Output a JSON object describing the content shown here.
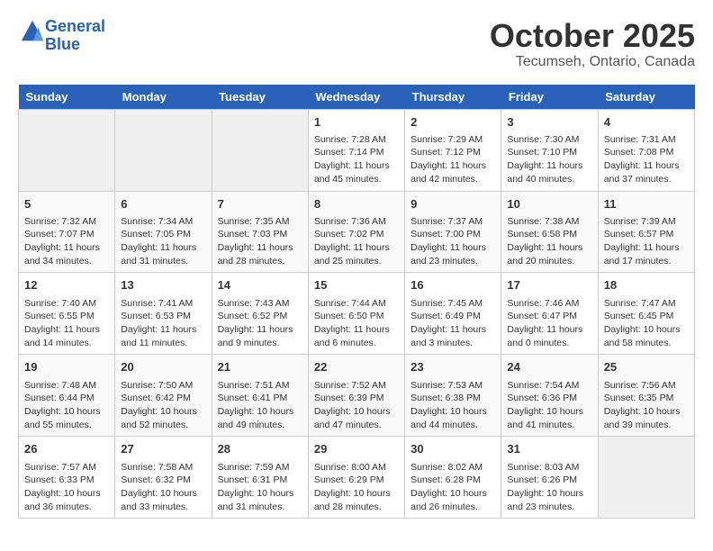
{
  "logo": {
    "line1": "General",
    "line2": "Blue"
  },
  "title": "October 2025",
  "subtitle": "Tecumseh, Ontario, Canada",
  "weekdays": [
    "Sunday",
    "Monday",
    "Tuesday",
    "Wednesday",
    "Thursday",
    "Friday",
    "Saturday"
  ],
  "weeks": [
    [
      {
        "day": "",
        "info": ""
      },
      {
        "day": "",
        "info": ""
      },
      {
        "day": "",
        "info": ""
      },
      {
        "day": "1",
        "info": "Sunrise: 7:28 AM\nSunset: 7:14 PM\nDaylight: 11 hours and 45 minutes."
      },
      {
        "day": "2",
        "info": "Sunrise: 7:29 AM\nSunset: 7:12 PM\nDaylight: 11 hours and 42 minutes."
      },
      {
        "day": "3",
        "info": "Sunrise: 7:30 AM\nSunset: 7:10 PM\nDaylight: 11 hours and 40 minutes."
      },
      {
        "day": "4",
        "info": "Sunrise: 7:31 AM\nSunset: 7:08 PM\nDaylight: 11 hours and 37 minutes."
      }
    ],
    [
      {
        "day": "5",
        "info": "Sunrise: 7:32 AM\nSunset: 7:07 PM\nDaylight: 11 hours and 34 minutes."
      },
      {
        "day": "6",
        "info": "Sunrise: 7:34 AM\nSunset: 7:05 PM\nDaylight: 11 hours and 31 minutes."
      },
      {
        "day": "7",
        "info": "Sunrise: 7:35 AM\nSunset: 7:03 PM\nDaylight: 11 hours and 28 minutes."
      },
      {
        "day": "8",
        "info": "Sunrise: 7:36 AM\nSunset: 7:02 PM\nDaylight: 11 hours and 25 minutes."
      },
      {
        "day": "9",
        "info": "Sunrise: 7:37 AM\nSunset: 7:00 PM\nDaylight: 11 hours and 23 minutes."
      },
      {
        "day": "10",
        "info": "Sunrise: 7:38 AM\nSunset: 6:58 PM\nDaylight: 11 hours and 20 minutes."
      },
      {
        "day": "11",
        "info": "Sunrise: 7:39 AM\nSunset: 6:57 PM\nDaylight: 11 hours and 17 minutes."
      }
    ],
    [
      {
        "day": "12",
        "info": "Sunrise: 7:40 AM\nSunset: 6:55 PM\nDaylight: 11 hours and 14 minutes."
      },
      {
        "day": "13",
        "info": "Sunrise: 7:41 AM\nSunset: 6:53 PM\nDaylight: 11 hours and 11 minutes."
      },
      {
        "day": "14",
        "info": "Sunrise: 7:43 AM\nSunset: 6:52 PM\nDaylight: 11 hours and 9 minutes."
      },
      {
        "day": "15",
        "info": "Sunrise: 7:44 AM\nSunset: 6:50 PM\nDaylight: 11 hours and 6 minutes."
      },
      {
        "day": "16",
        "info": "Sunrise: 7:45 AM\nSunset: 6:49 PM\nDaylight: 11 hours and 3 minutes."
      },
      {
        "day": "17",
        "info": "Sunrise: 7:46 AM\nSunset: 6:47 PM\nDaylight: 11 hours and 0 minutes."
      },
      {
        "day": "18",
        "info": "Sunrise: 7:47 AM\nSunset: 6:45 PM\nDaylight: 10 hours and 58 minutes."
      }
    ],
    [
      {
        "day": "19",
        "info": "Sunrise: 7:48 AM\nSunset: 6:44 PM\nDaylight: 10 hours and 55 minutes."
      },
      {
        "day": "20",
        "info": "Sunrise: 7:50 AM\nSunset: 6:42 PM\nDaylight: 10 hours and 52 minutes."
      },
      {
        "day": "21",
        "info": "Sunrise: 7:51 AM\nSunset: 6:41 PM\nDaylight: 10 hours and 49 minutes."
      },
      {
        "day": "22",
        "info": "Sunrise: 7:52 AM\nSunset: 6:39 PM\nDaylight: 10 hours and 47 minutes."
      },
      {
        "day": "23",
        "info": "Sunrise: 7:53 AM\nSunset: 6:38 PM\nDaylight: 10 hours and 44 minutes."
      },
      {
        "day": "24",
        "info": "Sunrise: 7:54 AM\nSunset: 6:36 PM\nDaylight: 10 hours and 41 minutes."
      },
      {
        "day": "25",
        "info": "Sunrise: 7:56 AM\nSunset: 6:35 PM\nDaylight: 10 hours and 39 minutes."
      }
    ],
    [
      {
        "day": "26",
        "info": "Sunrise: 7:57 AM\nSunset: 6:33 PM\nDaylight: 10 hours and 36 minutes."
      },
      {
        "day": "27",
        "info": "Sunrise: 7:58 AM\nSunset: 6:32 PM\nDaylight: 10 hours and 33 minutes."
      },
      {
        "day": "28",
        "info": "Sunrise: 7:59 AM\nSunset: 6:31 PM\nDaylight: 10 hours and 31 minutes."
      },
      {
        "day": "29",
        "info": "Sunrise: 8:00 AM\nSunset: 6:29 PM\nDaylight: 10 hours and 28 minutes."
      },
      {
        "day": "30",
        "info": "Sunrise: 8:02 AM\nSunset: 6:28 PM\nDaylight: 10 hours and 26 minutes."
      },
      {
        "day": "31",
        "info": "Sunrise: 8:03 AM\nSunset: 6:26 PM\nDaylight: 10 hours and 23 minutes."
      },
      {
        "day": "",
        "info": ""
      }
    ]
  ]
}
